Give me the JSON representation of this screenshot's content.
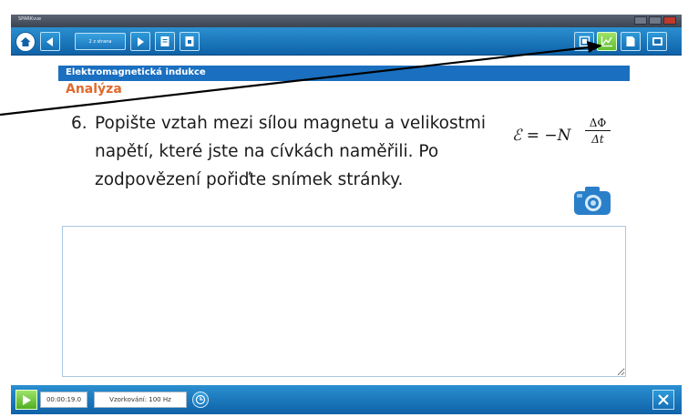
{
  "window": {
    "title": "SPARKvue"
  },
  "toolbar": {
    "page_indicator": "2 z strana",
    "left_buttons": [
      "home-icon",
      "arrow-left-icon",
      "arrow-right-icon",
      "journal-icon",
      "page-icon"
    ],
    "right_buttons": [
      "page-tools-icon",
      "graph-icon",
      "notes-icon",
      "add-page-icon"
    ]
  },
  "content": {
    "section_title": "Elektromagnetická indukce",
    "page_title": "Analýza",
    "question_number": "6.",
    "question_text": "Popište vztah mezi sílou magnetu a velikostmi napětí, které jste na cívkách naměřili. Po zodpovězení pořiďte snímek stránky.",
    "formula": {
      "lhs": "ℰ = −N",
      "numerator": "ΔΦ",
      "denominator": "Δt"
    },
    "answer_value": ""
  },
  "bottombar": {
    "timer": "00:00:19.0",
    "sample_rate": "Vzorkování: 100 Hz"
  },
  "colors": {
    "toolbar_blue": "#1670b5",
    "section_bar": "#1a6fc0",
    "page_title": "#e06a2e",
    "accent_green": "#5fbf2e",
    "annotation_arrow": "#000000"
  }
}
